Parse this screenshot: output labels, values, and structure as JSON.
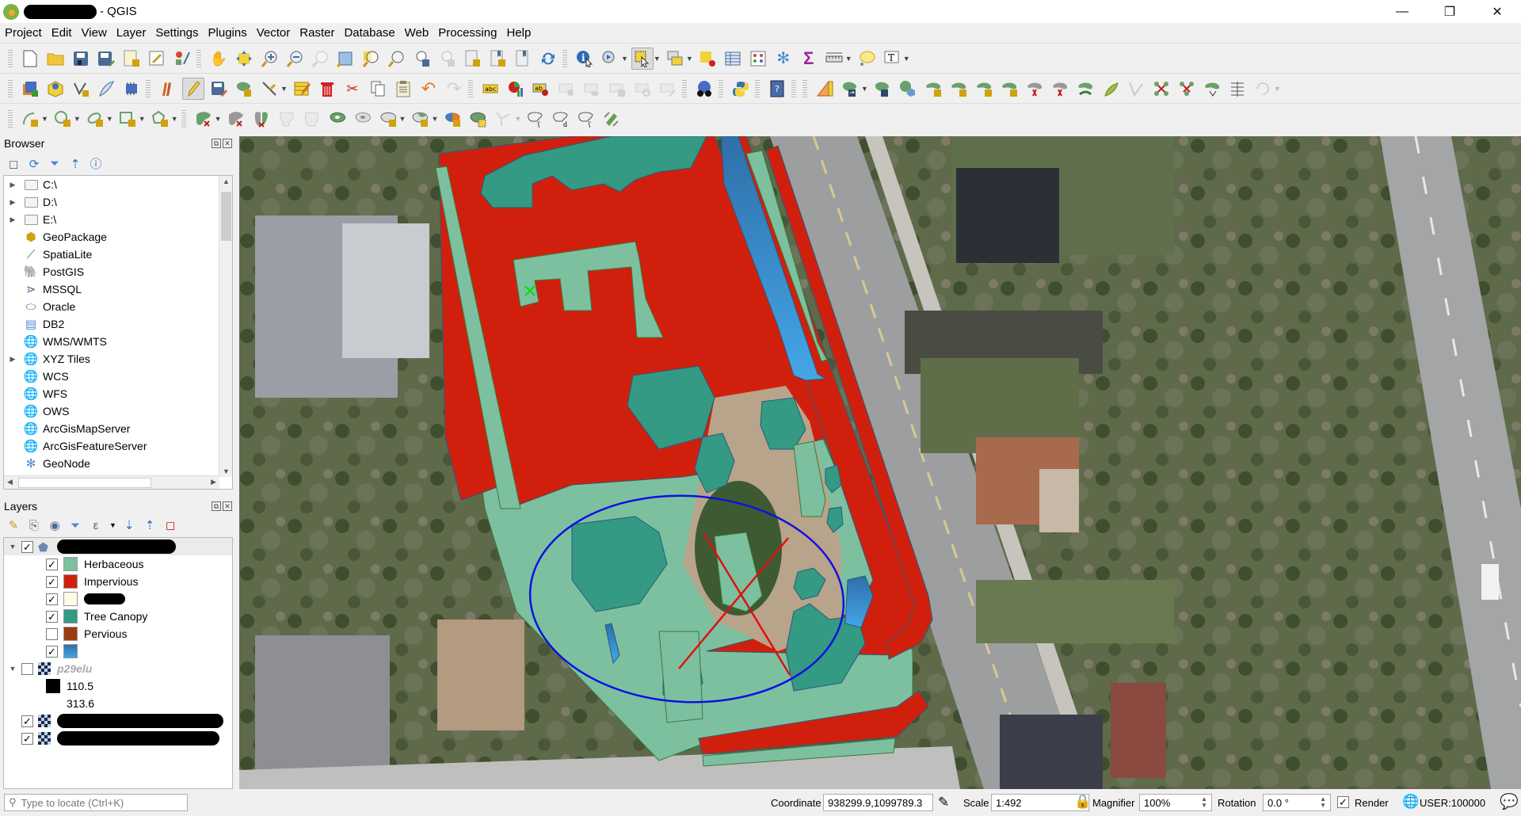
{
  "window": {
    "app_name": "- QGIS",
    "controls": {
      "minimize": "—",
      "restore": "❐",
      "close": "✕"
    }
  },
  "menu": [
    "Project",
    "Edit",
    "View",
    "Layer",
    "Settings",
    "Plugins",
    "Vector",
    "Raster",
    "Database",
    "Web",
    "Processing",
    "Help"
  ],
  "toolbars": {
    "row1": [
      "new-project",
      "open-project",
      "save-project",
      "save-as",
      "new-print-layout",
      "layout-manager",
      "style-manager",
      "|",
      "pan",
      "pan-to-selection",
      "zoom-in",
      "zoom-out",
      "zoom-native",
      "zoom-full",
      "zoom-to-selection",
      "zoom-to-layer",
      "zoom-last",
      "zoom-next",
      "new-bookmark",
      "show-bookmarks",
      "show-spatial-bookmarks",
      "refresh",
      "|",
      "identify",
      "run-action",
      "select-features",
      "select-by-value",
      "deselect-all",
      "open-attribute-table",
      "field-calculator",
      "toolbox",
      "statistics",
      "measure",
      "map-tips",
      "text-annotation"
    ],
    "row2": [
      "data-source-manager",
      "new-geopackage",
      "new-shapefile",
      "new-spatialite",
      "new-virtual-layer",
      "|",
      "current-edits",
      "toggle-editing",
      "save-edits",
      "add-feature",
      "vertex-tool",
      "modify-attributes",
      "delete-selected",
      "cut-features",
      "copy-features",
      "paste-features",
      "undo",
      "redo",
      "|",
      "label-tool",
      "diagram",
      "pin-labels",
      "highlight-labels",
      "show-hide-labels",
      "move-label",
      "rotate-label",
      "change-label",
      "|",
      "metasearch",
      "|",
      "python-console",
      "|",
      "help",
      "|",
      "cad-tools",
      "add-ring",
      "add-part",
      "fill-ring",
      "delete-ring",
      "delete-part",
      "reshape",
      "offset-curve",
      "split-features",
      "split-parts",
      "merge-features",
      "merge-attributes",
      "rotate-point",
      "simplify",
      "rotate-feature"
    ],
    "row3": [
      "add-line",
      "add-circle",
      "add-ellipse",
      "add-rectangle",
      "add-polygon",
      "|",
      "split",
      "split-parts",
      "merge",
      "reshape",
      "offset",
      "fill-ring",
      "delete-ring",
      "add-ring",
      "add-part",
      "tracing",
      "snapping",
      "select-vertex",
      "deselect",
      "reverse",
      "reverse-line",
      "georeference"
    ]
  },
  "browser": {
    "title": "Browser",
    "items": [
      {
        "label": "C:\\",
        "icon": "folder-icon",
        "expandable": true
      },
      {
        "label": "D:\\",
        "icon": "folder-icon",
        "expandable": true
      },
      {
        "label": "E:\\",
        "icon": "folder-icon",
        "expandable": true
      },
      {
        "label": "GeoPackage",
        "icon": "geopackage-icon",
        "expandable": false
      },
      {
        "label": "SpatiaLite",
        "icon": "spatialite-icon",
        "expandable": false
      },
      {
        "label": "PostGIS",
        "icon": "postgis-icon",
        "expandable": false
      },
      {
        "label": "MSSQL",
        "icon": "mssql-icon",
        "expandable": false
      },
      {
        "label": "Oracle",
        "icon": "oracle-icon",
        "expandable": false
      },
      {
        "label": "DB2",
        "icon": "db2-icon",
        "expandable": false
      },
      {
        "label": "WMS/WMTS",
        "icon": "wms-icon",
        "expandable": false
      },
      {
        "label": "XYZ Tiles",
        "icon": "xyz-icon",
        "expandable": true
      },
      {
        "label": "WCS",
        "icon": "wcs-icon",
        "expandable": false
      },
      {
        "label": "WFS",
        "icon": "wfs-icon",
        "expandable": false
      },
      {
        "label": "OWS",
        "icon": "ows-icon",
        "expandable": false
      },
      {
        "label": "ArcGisMapServer",
        "icon": "arcgis-map-icon",
        "expandable": false
      },
      {
        "label": "ArcGisFeatureServer",
        "icon": "arcgis-feature-icon",
        "expandable": false
      },
      {
        "label": "GeoNode",
        "icon": "geonode-icon",
        "expandable": false
      }
    ]
  },
  "layers": {
    "title": "Layers",
    "group_vector": {
      "checked": true,
      "name_redacted": true
    },
    "categories": [
      {
        "label": "Herbaceous",
        "color": "#7dc0a0",
        "checked": true
      },
      {
        "label": "Impervious",
        "color": "#d0200d",
        "checked": true
      },
      {
        "label": "",
        "color": "#fdfbea",
        "checked": true,
        "redacted": true
      },
      {
        "label": "Tree Canopy",
        "color": "#349a83",
        "checked": true
      },
      {
        "label": "Pervious",
        "color": "#9c3a10",
        "checked": false
      },
      {
        "label": "",
        "color": "#3a8fd0",
        "checked": true
      }
    ],
    "raster_group": {
      "label": "p29elu",
      "checked": false,
      "legend": [
        {
          "label": "110.5",
          "color": "#000000"
        },
        {
          "label": "313.6",
          "color": "#ffffff"
        }
      ]
    },
    "other_layers": [
      {
        "checked": true,
        "redacted": true
      },
      {
        "checked": true,
        "redacted": true
      }
    ]
  },
  "map": {
    "colors": {
      "herbaceous": "#7dc0a0",
      "impervious": "#d0200d",
      "tree_canopy": "#349a83",
      "water": "#3a8fd0",
      "ellipse": "#1010e0",
      "cross": "#e01010",
      "marker": "#00e000"
    }
  },
  "statusbar": {
    "locator_placeholder": "Type to locate (Ctrl+K)",
    "coordinate_label": "Coordinate",
    "coordinate_value": "938299.9,1099789.3",
    "scale_label": "Scale",
    "scale_value": "1:492",
    "magnifier_label": "Magnifier",
    "magnifier_value": "100%",
    "rotation_label": "Rotation",
    "rotation_value": "0.0 °",
    "render_label": "Render",
    "render_checked": true,
    "crs": "USER:100000"
  }
}
